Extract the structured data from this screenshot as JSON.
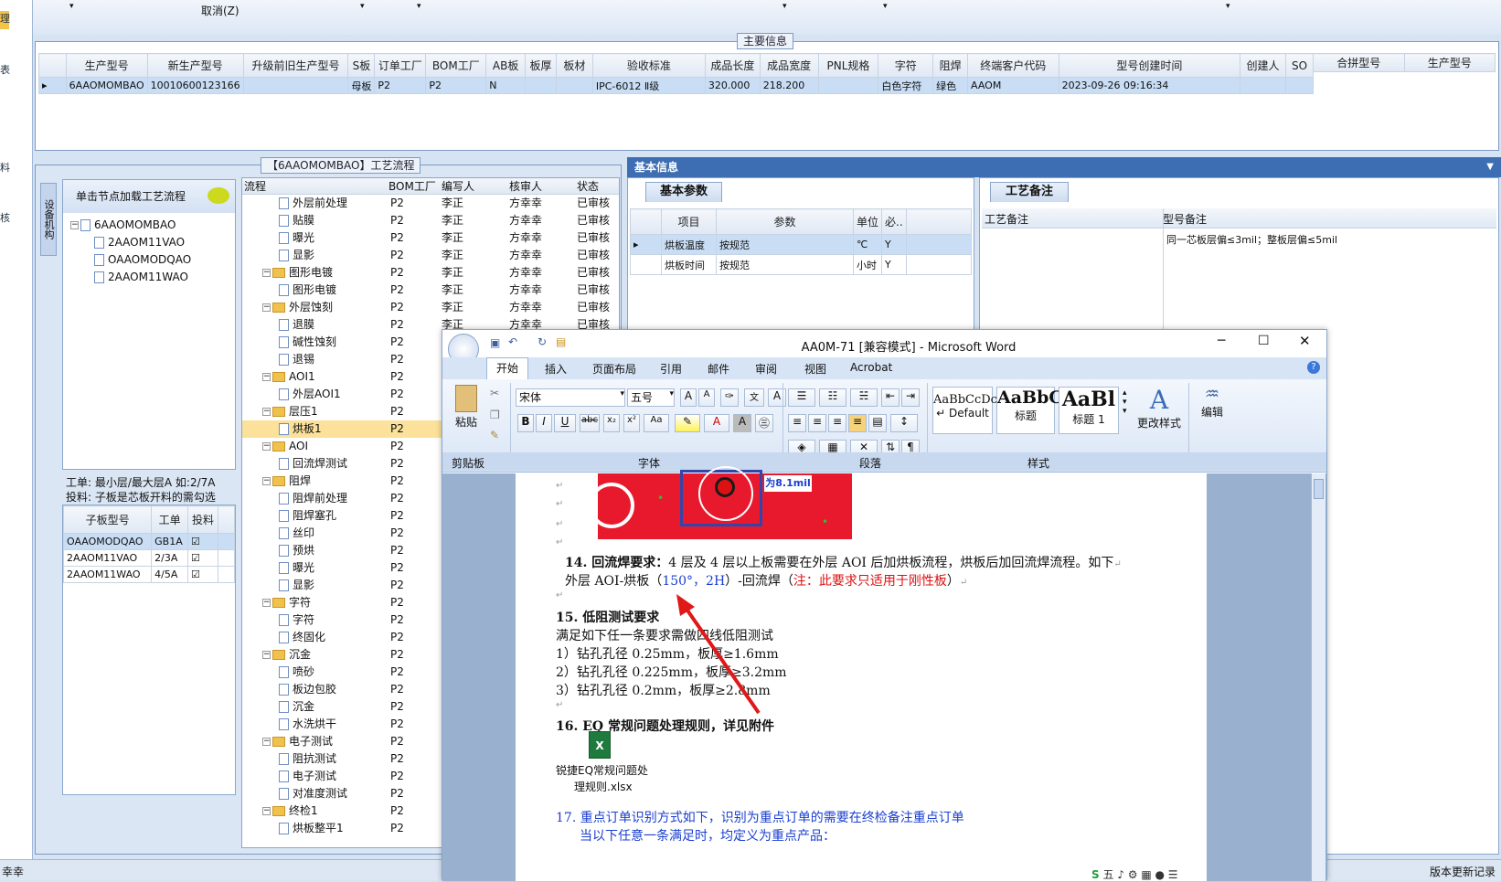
{
  "left_strip": {
    "items": [
      "理",
      "表",
      "料",
      "核"
    ]
  },
  "topbar": {
    "cancel": "取消(Z)"
  },
  "main_info": {
    "title": "主要信息",
    "columns": [
      "生产型号",
      "新生产型号",
      "升级前旧生产型号",
      "S板",
      "订单工厂",
      "BOM工厂",
      "AB板",
      "板厚",
      "板材",
      "验收标准",
      "成品长度",
      "成品宽度",
      "PNL规格",
      "字符",
      "阻焊",
      "终端客户代码",
      "型号创建时间",
      "创建人",
      "SO"
    ],
    "row": [
      "6AAOMOMBAO",
      "10010600123166",
      "",
      "母板",
      "P2",
      "P2",
      "N",
      "",
      "",
      "IPC-6012 Ⅱ级",
      "320.000",
      "218.200",
      "",
      "白色字符",
      "绿色",
      "AAOM",
      "2023-09-26 09:16:34",
      "",
      ""
    ],
    "merge_columns": [
      "合拼型号",
      "生产型号"
    ]
  },
  "process": {
    "title": "【6AAOMOMBAO】工艺流程",
    "side_tab": "设备机构",
    "load_label": "单击节点加载工艺流程",
    "tree": [
      "6AAOMOMBAO",
      "2AAOM11VAO",
      "OAAOMODQAO",
      "2AAOM11WAO"
    ],
    "note1": "工单: 最小层/最大层A 如:2/7A",
    "note2": "投料: 子板是芯板开料的需勾选",
    "sub_cols": [
      "子板型号",
      "工单",
      "投料"
    ],
    "sub_rows": [
      [
        "OAAOMODQAO",
        "GB1A"
      ],
      [
        "2AAOM11VAO",
        "2/3A"
      ],
      [
        "2AAOM11WAO",
        "4/5A"
      ]
    ],
    "flow_cols": [
      "流程",
      "BOM工厂",
      "编写人",
      "核审人",
      "状态"
    ],
    "flow": [
      [
        "外层前处理",
        "P2",
        "李正",
        "方幸幸",
        "已审核",
        2,
        0
      ],
      [
        "贴膜",
        "P2",
        "李正",
        "方幸幸",
        "已审核",
        2,
        0
      ],
      [
        "曝光",
        "P2",
        "李正",
        "方幸幸",
        "已审核",
        2,
        0
      ],
      [
        "显影",
        "P2",
        "李正",
        "方幸幸",
        "已审核",
        2,
        0
      ],
      [
        "图形电镀",
        "P2",
        "李正",
        "方幸幸",
        "已审核",
        1,
        1
      ],
      [
        "图形电镀",
        "P2",
        "李正",
        "方幸幸",
        "已审核",
        2,
        0
      ],
      [
        "外层蚀刻",
        "P2",
        "李正",
        "方幸幸",
        "已审核",
        1,
        1
      ],
      [
        "退膜",
        "P2",
        "李正",
        "方幸幸",
        "已审核",
        2,
        0
      ],
      [
        "碱性蚀刻",
        "P2",
        "",
        "",
        "",
        2,
        0
      ],
      [
        "退锡",
        "P2",
        "",
        "",
        "",
        2,
        0
      ],
      [
        "AOI1",
        "P2",
        "",
        "",
        "",
        1,
        1
      ],
      [
        "外层AOI1",
        "P2",
        "",
        "",
        "",
        2,
        0
      ],
      [
        "层压1",
        "P2",
        "",
        "",
        "",
        1,
        1
      ],
      [
        "烘板1",
        "P2",
        "",
        "",
        "",
        2,
        0
      ],
      [
        "AOI",
        "P2",
        "",
        "",
        "",
        1,
        1
      ],
      [
        "回流焊测试",
        "P2",
        "",
        "",
        "",
        2,
        0
      ],
      [
        "阻焊",
        "P2",
        "",
        "",
        "",
        1,
        1
      ],
      [
        "阻焊前处理",
        "P2",
        "",
        "",
        "",
        2,
        0
      ],
      [
        "阻焊塞孔",
        "P2",
        "",
        "",
        "",
        2,
        0
      ],
      [
        "丝印",
        "P2",
        "",
        "",
        "",
        2,
        0
      ],
      [
        "预烘",
        "P2",
        "",
        "",
        "",
        2,
        0
      ],
      [
        "曝光",
        "P2",
        "",
        "",
        "",
        2,
        0
      ],
      [
        "显影",
        "P2",
        "",
        "",
        "",
        2,
        0
      ],
      [
        "字符",
        "P2",
        "",
        "",
        "",
        1,
        1
      ],
      [
        "字符",
        "P2",
        "",
        "",
        "",
        2,
        0
      ],
      [
        "终固化",
        "P2",
        "",
        "",
        "",
        2,
        0
      ],
      [
        "沉金",
        "P2",
        "",
        "",
        "",
        1,
        1
      ],
      [
        "喷砂",
        "P2",
        "",
        "",
        "",
        2,
        0
      ],
      [
        "板边包胶",
        "P2",
        "",
        "",
        "",
        2,
        0
      ],
      [
        "沉金",
        "P2",
        "",
        "",
        "",
        2,
        0
      ],
      [
        "水洗烘干",
        "P2",
        "",
        "",
        "",
        2,
        0
      ],
      [
        "电子测试",
        "P2",
        "",
        "",
        "",
        1,
        1
      ],
      [
        "阻抗测试",
        "P2",
        "",
        "",
        "",
        2,
        0
      ],
      [
        "电子测试",
        "P2",
        "",
        "",
        "",
        2,
        0
      ],
      [
        "对准度测试",
        "P2",
        "",
        "",
        "",
        2,
        0
      ],
      [
        "终检1",
        "P2",
        "",
        "",
        "",
        1,
        1
      ],
      [
        "烘板整平1",
        "P2",
        "",
        "",
        "",
        2,
        0
      ]
    ]
  },
  "basic": {
    "header": "基本信息",
    "tab": "基本参数",
    "cols": [
      "项目",
      "参数",
      "单位",
      "必.."
    ],
    "rows": [
      [
        "烘板温度",
        "按规范",
        "℃",
        "Y"
      ],
      [
        "烘板时间",
        "按规范",
        "小时",
        "Y"
      ]
    ],
    "note_tab": "工艺备注",
    "note_cols": [
      "工艺备注",
      "型号备注"
    ],
    "note_text": "同一芯板层偏≤3mil；整板层偏≤5mil"
  },
  "status": {
    "left": "幸幸",
    "right": "版本更新记录"
  },
  "word": {
    "title": "AA0M-71 [兼容模式] - Microsoft Word",
    "tabs": [
      "开始",
      "插入",
      "页面布局",
      "引用",
      "邮件",
      "审阅",
      "视图",
      "Acrobat"
    ],
    "paste": "粘贴",
    "font_name": "宋体",
    "font_size": "五号",
    "groups": [
      "剪贴板",
      "字体",
      "段落",
      "样式"
    ],
    "styles": [
      {
        "sample": "AaBbCcDc",
        "name": "↵ Default"
      },
      {
        "sample": "AaBbC",
        "name": "标题"
      },
      {
        "sample": "AaBl",
        "name": "标题 1"
      }
    ],
    "change_styles": "更改样式",
    "edit": "编辑",
    "img_label": "为8.1mil",
    "p14_title": "14. 回流焊要求：",
    "p14_text": "4 层及 4 层以上板需要在外层 AOI 后加烘板流程，烘板后加回流焊流程。如下",
    "p14b_a": "外层 AOI-烘板（",
    "p14b_b": "150°，2H",
    "p14b_c": "）-回流焊（",
    "p14b_d": "注：此要求只适用于刚性板",
    "p14b_e": "）",
    "p15_title": "15. 低阻测试要求",
    "p15_1": "满足如下任一条要求需做四线低阻测试",
    "p15_2": "1）钻孔孔径 0.25mm，板厚≥1.6mm",
    "p15_3": "2）钻孔孔径 0.225mm，板厚≥3.2mm",
    "p15_4": "3）钻孔孔径 0.2mm，板厚≥2.8mm",
    "p16": "16. EQ 常规问题处理规则，详见附件",
    "attach1": "锐捷EQ常规问题处",
    "attach2": "理规则.xlsx",
    "p17": "17. 重点订单识别方式如下，识别为重点订单的需要在终检备注重点订单",
    "p17b": "当以下任意一条满足时，均定义为重点产品：",
    "ime": "五"
  },
  "colors": {
    "accent": "#3d6db3",
    "red": "#d11",
    "blue": "#1a3fcf",
    "annotation_arrow": "#e01818"
  }
}
